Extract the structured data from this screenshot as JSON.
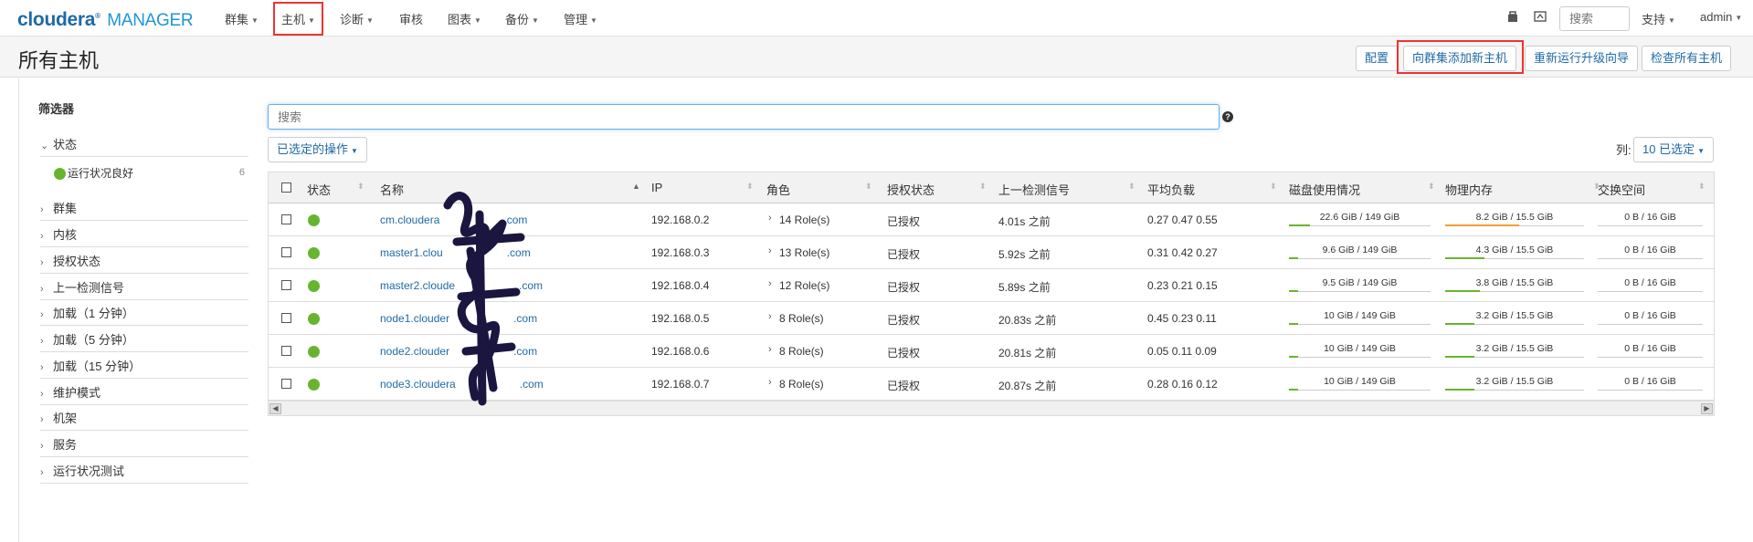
{
  "brand": {
    "name": "cloudera",
    "product": "MANAGER"
  },
  "nav": {
    "items": [
      {
        "label": "群集"
      },
      {
        "label": "主机"
      },
      {
        "label": "诊断"
      },
      {
        "label": "审核"
      },
      {
        "label": "图表"
      },
      {
        "label": "备份"
      },
      {
        "label": "管理"
      }
    ],
    "search_placeholder": "搜索",
    "support_label": "支持",
    "user_label": "admin"
  },
  "header": {
    "title": "所有主机",
    "buttons": {
      "configure": "配置",
      "add_hosts": "向群集添加新主机",
      "rerun_upgrade": "重新运行升级向导",
      "inspect_hosts": "检查所有主机"
    }
  },
  "filters": {
    "title": "筛选器",
    "status_label": "状态",
    "status_option": {
      "label": "运行状况良好",
      "count": "6"
    },
    "items": [
      "群集",
      "内核",
      "授权状态",
      "上一检测信号",
      "加载（1 分钟）",
      "加载（5 分钟）",
      "加载（15 分钟）",
      "维护模式",
      "机架",
      "服务",
      "运行状况测试"
    ]
  },
  "main": {
    "search_placeholder": "搜索",
    "help": "?",
    "actions_label": "已选定的操作",
    "columns_label": "列:",
    "columns_selected": "10 已选定"
  },
  "table": {
    "headers": [
      "状态",
      "名称",
      "IP",
      "角色",
      "授权状态",
      "上一检测信号",
      "平均负载",
      "磁盘使用情况",
      "物理内存",
      "交换空间"
    ],
    "rows": [
      {
        "name": "cm.cloudera",
        "name_suffix": ".com",
        "ip": "192.168.0.2",
        "roles": "14 Role(s)",
        "auth": "已授权",
        "heartbeat": "4.01s 之前",
        "load": "0.27  0.47  0.55",
        "disk": "22.6 GiB / 149 GiB",
        "disk_pct": 0.15,
        "mem": "8.2 GiB / 15.5 GiB",
        "mem_pct": 0.53,
        "swap": "0 B / 16 GiB"
      },
      {
        "name": "master1.clou",
        "name_suffix": ".com",
        "ip": "192.168.0.3",
        "roles": "13 Role(s)",
        "auth": "已授权",
        "heartbeat": "5.92s 之前",
        "load": "0.31  0.42  0.27",
        "disk": "9.6 GiB / 149 GiB",
        "disk_pct": 0.064,
        "mem": "4.3 GiB / 15.5 GiB",
        "mem_pct": 0.28,
        "swap": "0 B / 16 GiB"
      },
      {
        "name": "master2.cloude",
        "name_suffix": ".com",
        "ip": "192.168.0.4",
        "roles": "12 Role(s)",
        "auth": "已授权",
        "heartbeat": "5.89s 之前",
        "load": "0.23  0.21  0.15",
        "disk": "9.5 GiB / 149 GiB",
        "disk_pct": 0.064,
        "mem": "3.8 GiB / 15.5 GiB",
        "mem_pct": 0.25,
        "swap": "0 B / 16 GiB"
      },
      {
        "name": "node1.clouder",
        "name_suffix": ".com",
        "ip": "192.168.0.5",
        "roles": "8 Role(s)",
        "auth": "已授权",
        "heartbeat": "20.83s 之前",
        "load": "0.45  0.23  0.11",
        "disk": "10 GiB / 149 GiB",
        "disk_pct": 0.067,
        "mem": "3.2 GiB / 15.5 GiB",
        "mem_pct": 0.21,
        "swap": "0 B / 16 GiB"
      },
      {
        "name": "node2.clouder",
        "name_suffix": ".com",
        "ip": "192.168.0.6",
        "roles": "8 Role(s)",
        "auth": "已授权",
        "heartbeat": "20.81s 之前",
        "load": "0.05  0.11  0.09",
        "disk": "10 GiB / 149 GiB",
        "disk_pct": 0.067,
        "mem": "3.2 GiB / 15.5 GiB",
        "mem_pct": 0.21,
        "swap": "0 B / 16 GiB"
      },
      {
        "name": "node3.cloudera",
        "name_suffix": ".com",
        "ip": "192.168.0.7",
        "roles": "8 Role(s)",
        "auth": "已授权",
        "heartbeat": "20.87s 之前",
        "load": "0.28  0.16  0.12",
        "disk": "10 GiB / 149 GiB",
        "disk_pct": 0.067,
        "mem": "3.2 GiB / 15.5 GiB",
        "mem_pct": 0.21,
        "swap": "0 B / 16 GiB"
      }
    ]
  },
  "colors": {
    "accent": "#1f6aa5",
    "healthy": "#67b52f",
    "highlight": "#ee3333",
    "mem_warn": "#f0a030"
  }
}
